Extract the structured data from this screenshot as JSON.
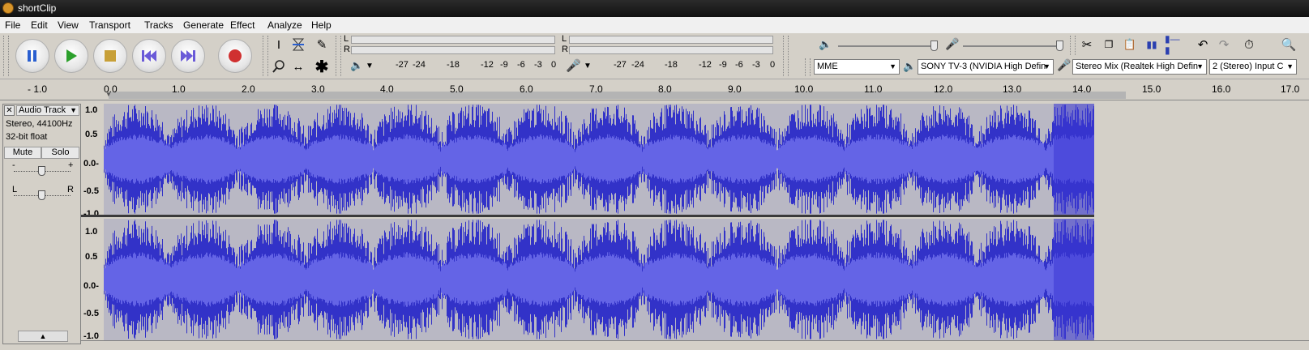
{
  "window": {
    "title": "shortClip"
  },
  "menu": [
    "File",
    "Edit",
    "View",
    "Transport",
    "Tracks",
    "Generate",
    "Effect",
    "Analyze",
    "Help"
  ],
  "transport": {
    "pause": "pause-button",
    "play": "play-button",
    "stop": "stop-button",
    "skip_start": "skip-to-start-button",
    "skip_end": "skip-to-end-button",
    "record": "record-button"
  },
  "meters": {
    "playback_scale": [
      "-27",
      "-24",
      "-18",
      "-12",
      "-9",
      "-6",
      "-3",
      "0"
    ],
    "record_scale": [
      "-27",
      "-24",
      "-18",
      "-12",
      "-9",
      "-6",
      "-3",
      "0"
    ],
    "lr": [
      "L",
      "R"
    ]
  },
  "devices": {
    "host": "MME",
    "playback": "SONY TV-3 (NVIDIA High Defin",
    "recording": "Stereo Mix (Realtek High Defin",
    "channels": "2 (Stereo) Input C"
  },
  "ruler": [
    "- 1.0",
    "0.0",
    "1.0",
    "2.0",
    "3.0",
    "4.0",
    "5.0",
    "6.0",
    "7.0",
    "8.0",
    "9.0",
    "10.0",
    "11.0",
    "12.0",
    "13.0",
    "14.0",
    "15.0",
    "16.0",
    "17.0"
  ],
  "track": {
    "name": "Audio Track",
    "info1": "Stereo, 44100Hz",
    "info2": "32-bit float",
    "mute": "Mute",
    "solo": "Solo",
    "gain_minus": "-",
    "gain_plus": "+",
    "pan_left": "L",
    "pan_right": "R",
    "scale": [
      "1.0",
      "0.5",
      "0.0-",
      "-0.5",
      "-1.0"
    ]
  },
  "colors": {
    "wave": "#3232c8",
    "wave_dark": "#2a2ab4",
    "wave_bg": "#b9b8c4",
    "selected": "#3a36d4"
  }
}
